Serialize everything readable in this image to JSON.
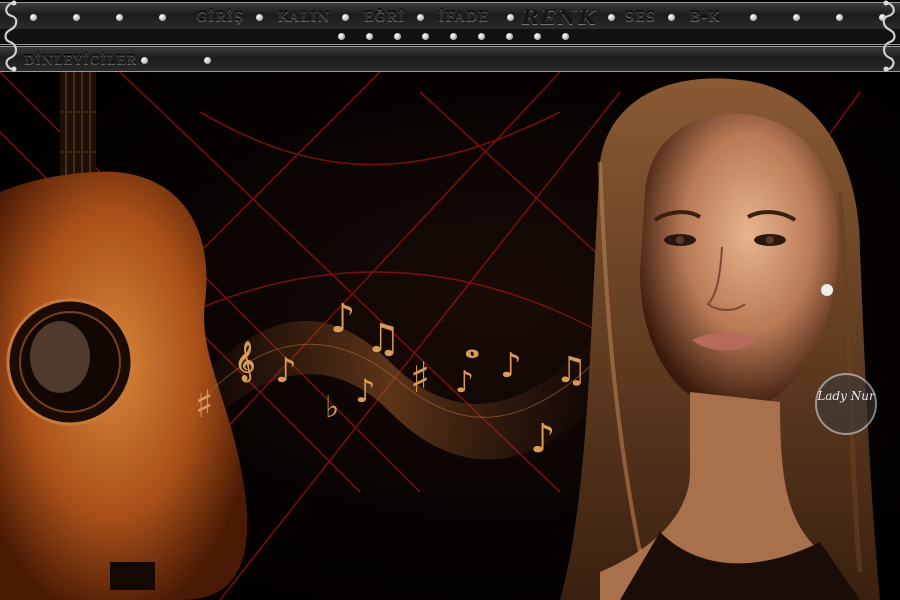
{
  "nav": {
    "items": [
      "GİRİŞ",
      "KALIN",
      "EĞRİ",
      "İFADE",
      "RENK",
      "SES",
      "B-K"
    ]
  },
  "second_bar": {
    "item": "DİNLEYİCİLER"
  },
  "signature": "Lady Nur",
  "colors": {
    "bar": "#2a2a2a",
    "background": "#000000",
    "accent_red": "#8a1010",
    "guitar": "#b5601f",
    "notes": "#d99a55"
  },
  "icons": {
    "left_cap": "ornament-scroll-icon",
    "right_cap": "ornament-scroll-icon",
    "bullets": "dot-icon"
  }
}
